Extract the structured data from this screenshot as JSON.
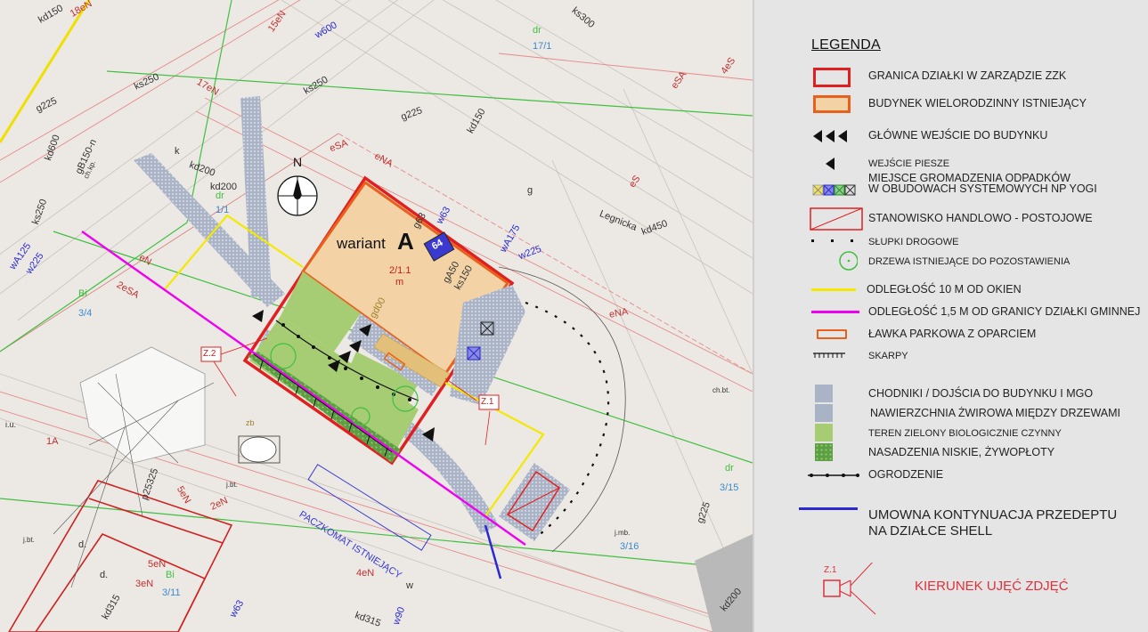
{
  "map": {
    "variant_label": "wariant",
    "variant_letter": "A",
    "building_number": "64",
    "parcel_label": "2/1.1",
    "parcel_sub": "m",
    "parcel_locker_label": "PACZKOMAT ISTNIEJĄCY",
    "north_label": "N",
    "street_label": "Legnicka",
    "photo_points": [
      "Z.1",
      "Z.2"
    ],
    "utility_labels": [
      "kd150",
      "18eN",
      "15eN",
      "w600",
      "ks250",
      "g225",
      "kd600",
      "ks250",
      "kd200",
      "17eN",
      "eSA",
      "eNA",
      "kd150",
      "g225",
      "ks300",
      "kd450",
      "wA175",
      "w225",
      "w63",
      "g63",
      "gA50",
      "ks150",
      "kd200",
      "dr",
      "1/1",
      "17/1",
      "Bi",
      "3/4",
      "2eSA",
      "eN",
      "wA125",
      "w225",
      "gB150-n",
      "ch.kp.",
      "j.bt.",
      "i.u.",
      "zb",
      "p25325",
      "5eN",
      "2eN",
      "4eN",
      "3eN",
      "5eN",
      "Bi",
      "3/11",
      "kd315",
      "w63",
      "w90",
      "kd315",
      "ch.bt.",
      "j.mb.",
      "3/16",
      "3/15",
      "dr",
      "g225",
      "kd200",
      "4eS",
      "eS",
      "eSA",
      "eNA",
      "1A",
      "j.bt.",
      "d.",
      "d.",
      "k",
      "g",
      "w",
      "ks250",
      "gd00",
      "dr"
    ]
  },
  "legend": {
    "title": "LEGENDA",
    "items": [
      {
        "label": "GRANICA DZIAŁKI W ZARZĄDZIE ZZK"
      },
      {
        "label": "BUDYNEK WIELORODZINNY ISTNIEJĄCY"
      },
      {
        "label": "GŁÓWNE WEJŚCIE DO BUDYNKU"
      },
      {
        "label": "WEJŚCIE PIESZE"
      },
      {
        "label": "MIEJSCE GROMADZENIA ODPADKÓW"
      },
      {
        "label": "W OBUDOWACH SYSTEMOWYCH NP YOGI"
      },
      {
        "label": "STANOWISKO HANDLOWO - POSTOJOWE"
      },
      {
        "label": "SŁUPKI DROGOWE"
      },
      {
        "label": "DRZEWA ISTNIEJĄCE DO POZOSTAWIENIA"
      },
      {
        "label": "ODLEGŁOŚĆ 10 M OD OKIEN"
      },
      {
        "label": "ODLEGŁOŚĆ 1,5 M OD GRANICY DZIAŁKI GMINNEJ"
      },
      {
        "label": "ŁAWKA PARKOWA Z OPARCIEM"
      },
      {
        "label": "SKARPY"
      },
      {
        "label": "CHODNIKI / DOJŚCIA DO BUDYNKU I MGO"
      },
      {
        "label": "NAWIERZCHNIA ŻWIROWA MIĘDZY DRZEWAMI"
      },
      {
        "label": "TEREN ZIELONY BIOLOGICZNIE CZYNNY"
      },
      {
        "label": "NASADZENIA NISKIE, ŻYWOPŁOTY"
      },
      {
        "label": "OGRODZENIE"
      },
      {
        "label": "UMOWNA KONTYNUACJA PRZEDEPTU NA DZIAŁCE SHELL"
      },
      {
        "label": "KIERUNEK UJĘĆ ZDJĘĆ"
      }
    ],
    "camera_tag": "Z.1"
  },
  "colors": {
    "parcel_border": "#e02020",
    "building_border": "#e8601c",
    "building_fill": "#f3d3a6",
    "ten_m_line": "#f5e800",
    "one_half_m_line": "#f000f0",
    "sidewalk": "#a9b3c6",
    "green_area": "#a7cd74",
    "hedge": "#5d9e45",
    "path_continuation": "#2a2ad0",
    "camera": "#e0303a"
  }
}
